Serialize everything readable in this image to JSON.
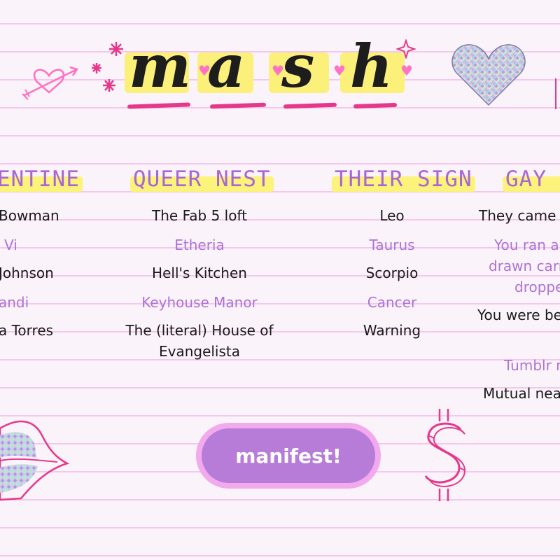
{
  "title": {
    "letters": [
      "m",
      "a",
      "s",
      "h"
    ]
  },
  "columns": [
    {
      "header": "ENTINE",
      "items": [
        {
          "text": "Bowman",
          "tone": "black"
        },
        {
          "text": "Vi",
          "tone": "purple"
        },
        {
          "text": "Johnson",
          "tone": "black"
        },
        {
          "text": "andi",
          "tone": "purple"
        },
        {
          "text": "a Torres",
          "tone": "black"
        }
      ]
    },
    {
      "header": "QUEER NEST",
      "items": [
        {
          "text": "The Fab 5 loft",
          "tone": "black"
        },
        {
          "text": "Etheria",
          "tone": "purple"
        },
        {
          "text": "Hell's Kitchen",
          "tone": "black"
        },
        {
          "text": "Keyhouse Manor",
          "tone": "purple"
        },
        {
          "text": "The (literal) House of",
          "tone": "black"
        },
        {
          "text": "Evangelista",
          "tone": "black"
        }
      ]
    },
    {
      "header": "THEIR SIGN",
      "items": [
        {
          "text": "Leo",
          "tone": "black"
        },
        {
          "text": "Taurus",
          "tone": "purple"
        },
        {
          "text": "Scorpio",
          "tone": "black"
        },
        {
          "text": "Cancer",
          "tone": "purple"
        },
        {
          "text": "Warning",
          "tone": "black"
        }
      ]
    },
    {
      "header": "GAY I",
      "items": [
        {
          "text": "They came t",
          "tone": "black"
        },
        {
          "text": "You ran a",
          "tone": "purple"
        },
        {
          "text": "drawn carr",
          "tone": "purple"
        },
        {
          "text": "droppe",
          "tone": "purple"
        },
        {
          "text": "You were be",
          "tone": "black"
        },
        {
          "text": "Tumblr m",
          "tone": "purple"
        },
        {
          "text": "Mutual nea",
          "tone": "black"
        }
      ]
    }
  ],
  "button": {
    "label": "manifest!"
  },
  "colors": {
    "accent_purple": "#ad72d6",
    "highlight_yellow": "#fbf07a",
    "pink": "#e6388a",
    "button": "#b67cd8"
  },
  "icons": [
    "heart-arrow-doodle-icon",
    "sparkle-icon",
    "holographic-heart-icon",
    "holographic-lips-icon",
    "dollar-sign-doodle-icon"
  ]
}
